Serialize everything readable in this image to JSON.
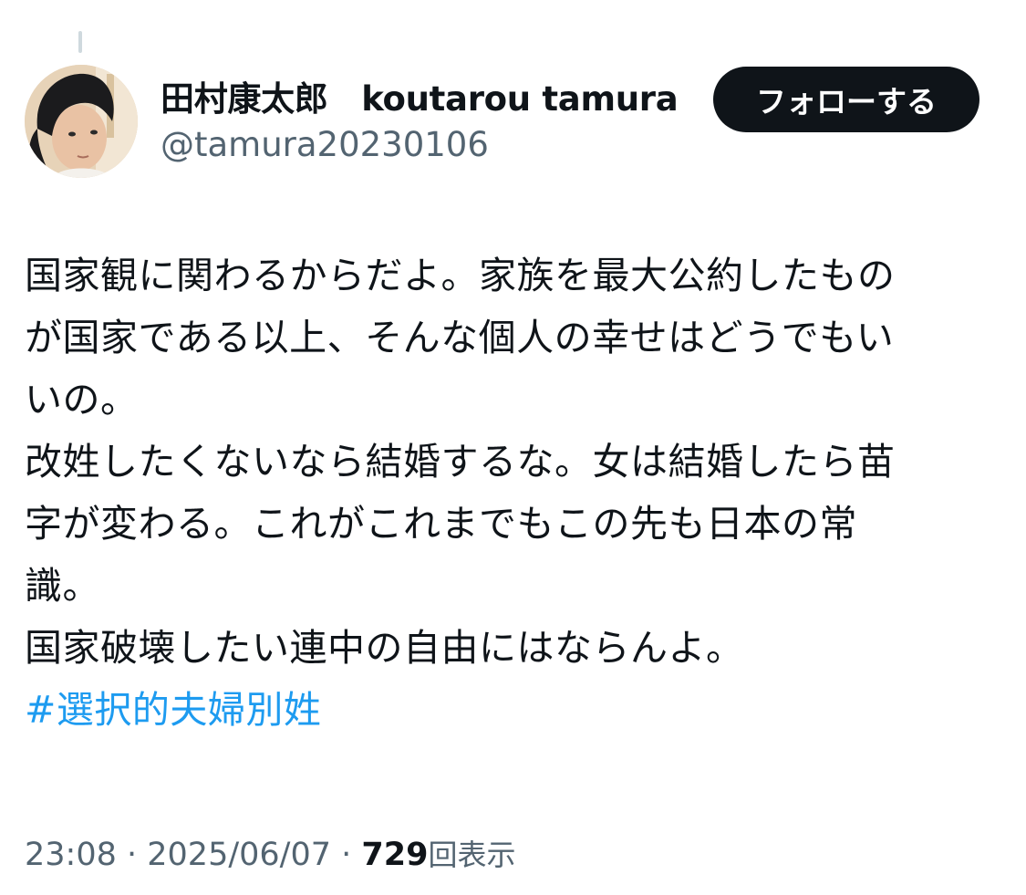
{
  "author": {
    "display_name": "田村康太郎　koutarou tamura",
    "handle": "@tamura20230106",
    "avatar_alt": "profile photo"
  },
  "follow_button": {
    "label": "フォローする"
  },
  "tweet": {
    "lines": [
      "国家観に関わるからだよ。家族を最大公約したもの",
      "が国家である以上、そんな個人の幸せはどうでもい",
      "いの。",
      "改姓したくないなら結婚するな。女は結婚したら苗",
      "字が変わる。これがこれまでもこの先も日本の常",
      "識。",
      "国家破壊したい連中の自由にはならんよ。"
    ],
    "hashtag": "#選択的夫婦別姓"
  },
  "meta": {
    "time": "23:08",
    "separator": " · ",
    "date": "2025/06/07",
    "views_count": "729",
    "views_label": "回表示"
  },
  "colors": {
    "text": "#0f1419",
    "secondary": "#536471",
    "link": "#1d9bf0",
    "button_bg": "#0f1419",
    "button_text": "#ffffff"
  }
}
